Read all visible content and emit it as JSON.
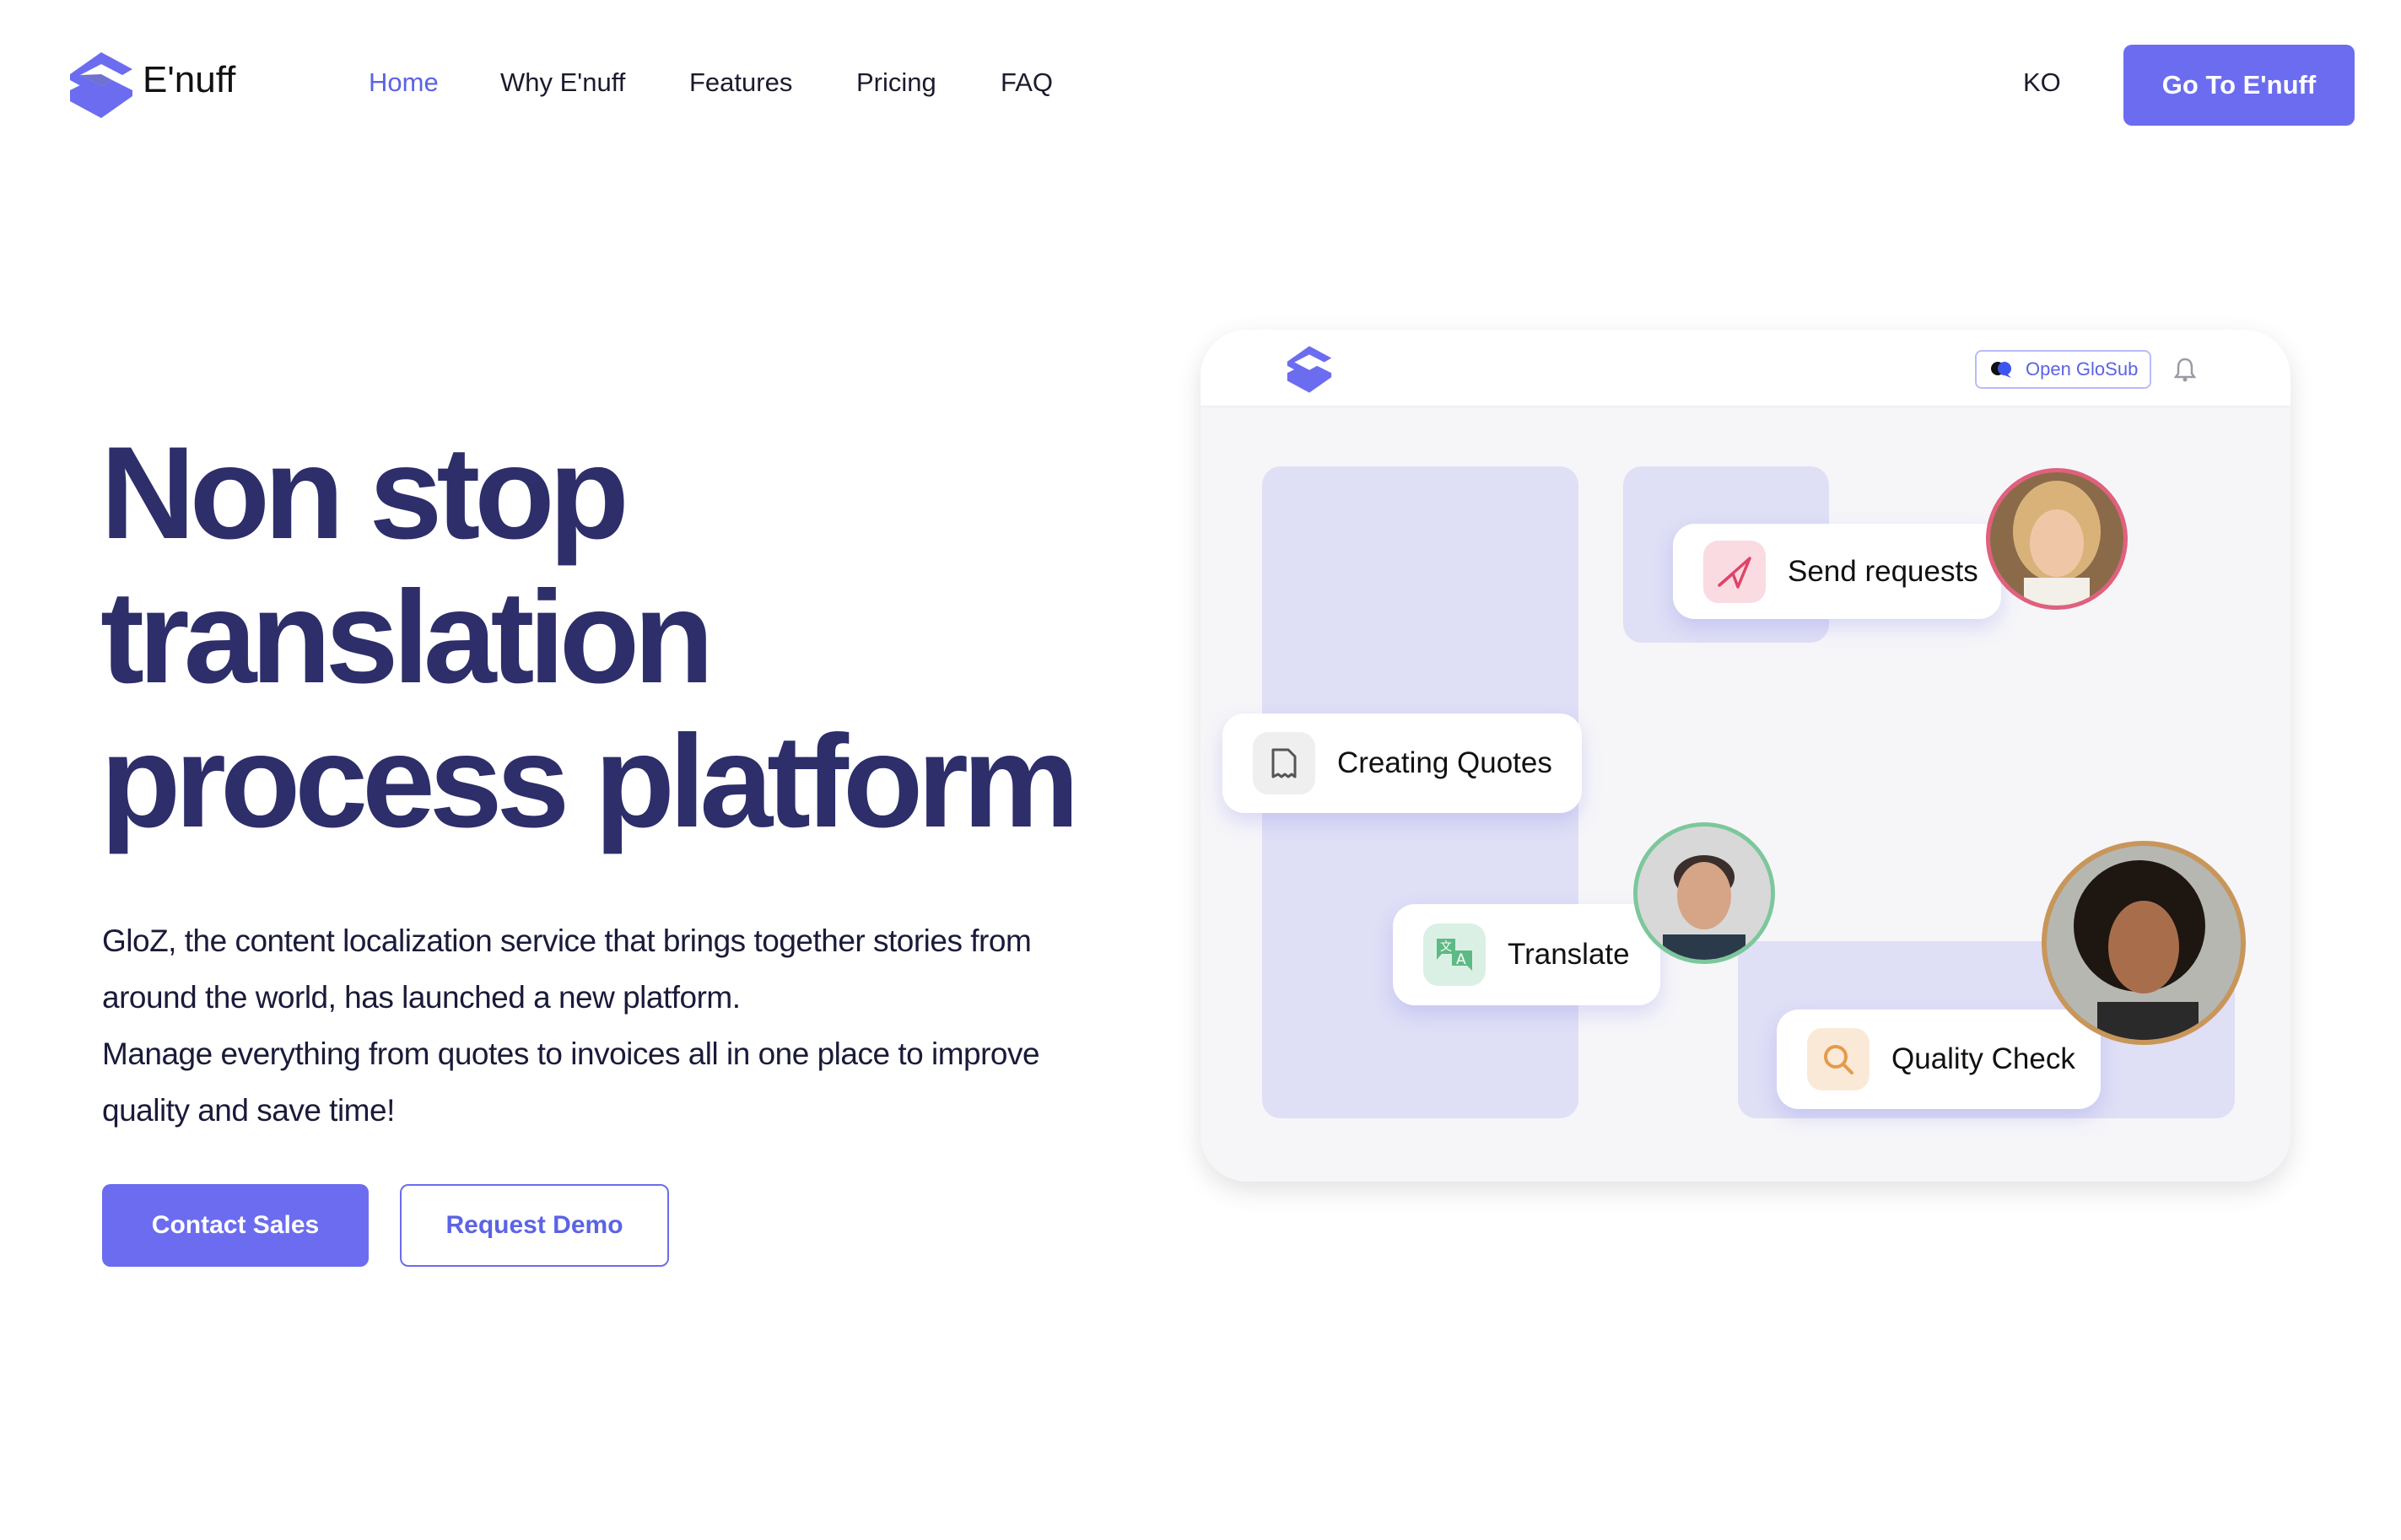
{
  "nav": {
    "brand": "E'nuff",
    "links": [
      "Home",
      "Why E'nuff",
      "Features",
      "Pricing",
      "FAQ"
    ],
    "language": "KO",
    "cta": "Go To E'nuff"
  },
  "hero": {
    "title_lines": [
      "Non stop",
      "translation",
      "process platform"
    ],
    "description_lines": [
      "GloZ, the content localization service that brings together stories from",
      "around the world, has launched a new platform.",
      "Manage everything from quotes to invoices all in one place to improve",
      "quality and save time!"
    ],
    "contact_sales": "Contact Sales",
    "request_demo": "Request Demo"
  },
  "preview": {
    "open_glosub": "Open GloSub",
    "steps": [
      "Send requests",
      "Creating Quotes",
      "Translate",
      "Quality Check"
    ]
  },
  "colors": {
    "accent": "#6c6cf0",
    "heading": "#2d2e6a"
  }
}
